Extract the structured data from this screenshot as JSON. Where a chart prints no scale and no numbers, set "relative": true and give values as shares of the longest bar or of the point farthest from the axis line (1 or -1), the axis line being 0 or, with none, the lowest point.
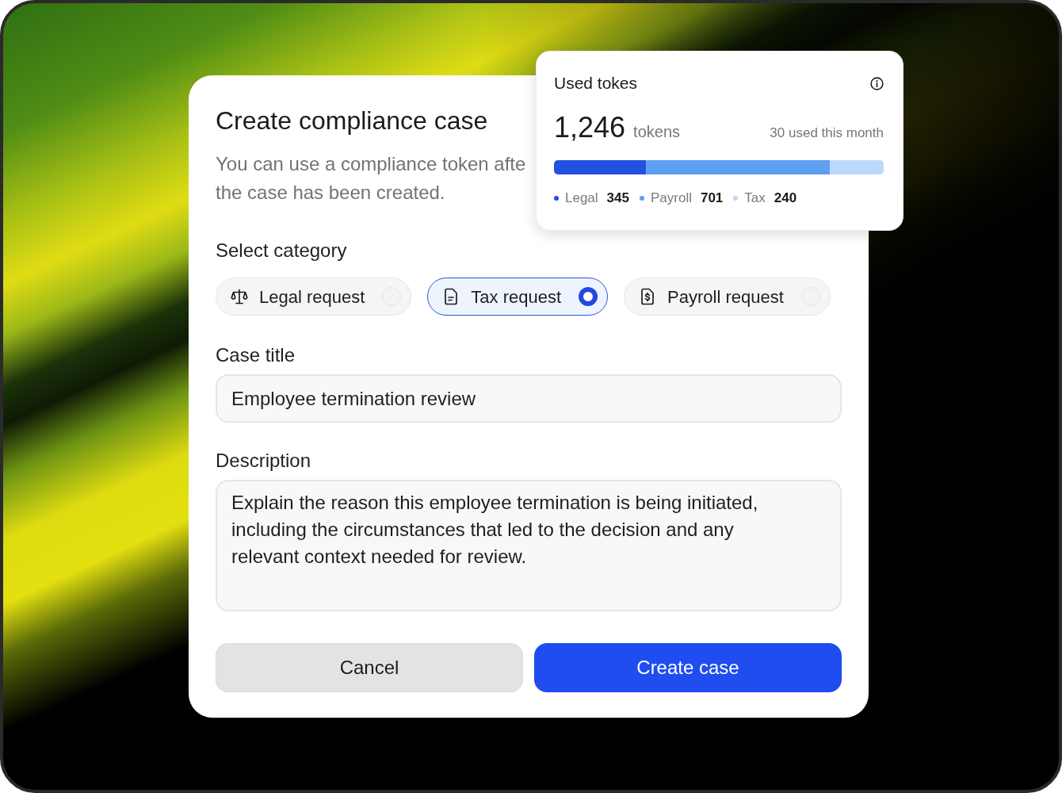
{
  "dialog": {
    "title": "Create compliance case",
    "subtitle_lines": [
      "You can use a compliance token afte",
      "the case has been created."
    ],
    "category_label": "Select category",
    "categories": [
      {
        "label": "Legal request",
        "selected": false
      },
      {
        "label": "Tax request",
        "selected": true
      },
      {
        "label": "Payroll request",
        "selected": false
      }
    ],
    "case_title": {
      "label": "Case title",
      "value": "Employee termination review"
    },
    "description": {
      "label": "Description",
      "value": "Explain the reason this employee termination is being initiated, including the circumstances that led to the decision and any relevant context needed for review."
    },
    "buttons": [
      {
        "kind": "secondary",
        "label": "Cancel"
      },
      {
        "kind": "primary",
        "label": "Create case"
      }
    ]
  },
  "usage_card": {
    "title": "Used tokes",
    "total": "1,246",
    "unit": "tokens",
    "note": "30 used this month",
    "chart_data": {
      "type": "bar",
      "orientation": "horizontal",
      "stacked": true,
      "relative": true,
      "series": [
        {
          "name": "Legal",
          "color": "#2450e0",
          "values": [
            0.28
          ]
        },
        {
          "name": "Payroll",
          "color": "#5e9ff2",
          "values": [
            0.557
          ]
        },
        {
          "name": "Tax",
          "color": "#bcd8fb",
          "values": [
            0.163
          ]
        }
      ]
    },
    "legend_values": [
      "345",
      "701",
      "240"
    ]
  }
}
